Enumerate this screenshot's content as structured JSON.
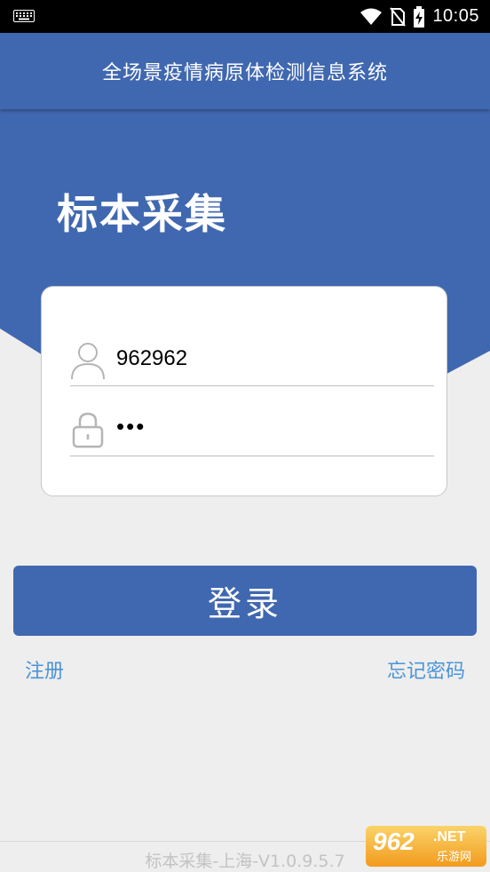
{
  "status_bar": {
    "time": "10:05"
  },
  "header": {
    "title": "全场景疫情病原体检测信息系统"
  },
  "hero": {
    "title": "标本采集"
  },
  "form": {
    "username_value": "962962",
    "password_value": "•••"
  },
  "actions": {
    "login_label": "登录",
    "register_label": "注册",
    "forgot_label": "忘记密码"
  },
  "footer": {
    "version_text": "标本采集-上海-V1.0.9.5.7"
  },
  "watermark": {
    "brand": "962",
    "net": ".NET",
    "cn": "乐游网"
  },
  "colors": {
    "primary": "#4068b0",
    "link": "#4a94d9",
    "background": "#eeeeee"
  }
}
